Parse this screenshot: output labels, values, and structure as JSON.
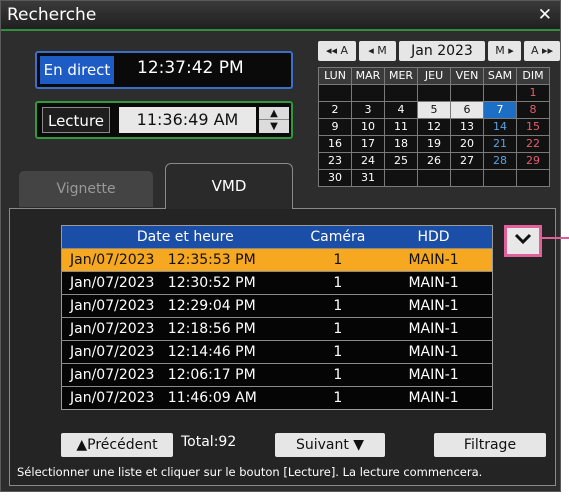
{
  "window": {
    "title": "Recherche",
    "close_symbol": "✕"
  },
  "live": {
    "label": "En direct",
    "time": "12:37:42 PM"
  },
  "playback": {
    "label": "Lecture",
    "time": "11:36:49 AM"
  },
  "calendar": {
    "nav": [
      "◂◂ A",
      "◂ M",
      "M ▸",
      "A ▸▸"
    ],
    "month": "Jan 2023",
    "weekdays": [
      "LUN",
      "MAR",
      "MER",
      "JEU",
      "VEN",
      "SAM",
      "DIM"
    ],
    "weeks": [
      [
        "",
        "",
        "",
        "",
        "",
        "",
        "1"
      ],
      [
        "2",
        "3",
        "4",
        "5",
        "6",
        "7",
        "8"
      ],
      [
        "9",
        "10",
        "11",
        "12",
        "13",
        "14",
        "15"
      ],
      [
        "16",
        "17",
        "18",
        "19",
        "20",
        "21",
        "22"
      ],
      [
        "23",
        "24",
        "25",
        "26",
        "27",
        "28",
        "29"
      ],
      [
        "30",
        "31",
        "",
        "",
        "",
        "",
        ""
      ]
    ],
    "selected_day": "7",
    "highlighted_days": [
      "5",
      "6"
    ]
  },
  "tabs": [
    {
      "label": "Vignette"
    },
    {
      "label": "VMD"
    }
  ],
  "table": {
    "headers": [
      "Date et heure",
      "Caméra",
      "HDD"
    ],
    "rows": [
      [
        "Jan/07/2023   12:35:53 PM",
        "1",
        "MAIN-1"
      ],
      [
        "Jan/07/2023   12:30:52 PM",
        "1",
        "MAIN-1"
      ],
      [
        "Jan/07/2023   12:29:04 PM",
        "1",
        "MAIN-1"
      ],
      [
        "Jan/07/2023   12:18:56 PM",
        "1",
        "MAIN-1"
      ],
      [
        "Jan/07/2023   12:14:46 PM",
        "1",
        "MAIN-1"
      ],
      [
        "Jan/07/2023   12:06:17 PM",
        "1",
        "MAIN-1"
      ],
      [
        "Jan/07/2023   11:46:09 AM",
        "1",
        "MAIN-1"
      ]
    ],
    "selected_row": 0
  },
  "footer": {
    "prev_label": "▲Précédent",
    "total": "Total:92",
    "next_label": "Suivant ▼",
    "filter_label": "Filtrage",
    "hint": "Sélectionner une liste et cliquer sur le bouton [Lecture]. La lecture commencera."
  },
  "colors": {
    "accent_blue": "#1b4ea6",
    "selected_row": "#f5a820",
    "callout": "#e0609a",
    "sunday": "#e06070",
    "saturday": "#5aa0e0"
  }
}
